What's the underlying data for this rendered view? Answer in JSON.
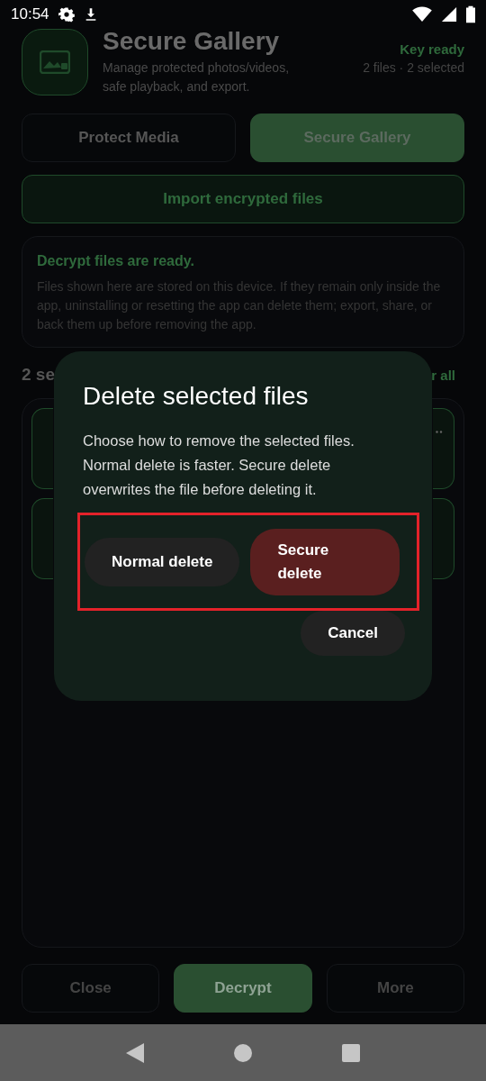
{
  "status_bar": {
    "time": "10:54"
  },
  "header": {
    "title": "Secure Gallery",
    "subtitle": "Manage protected photos/videos, safe playback, and export.",
    "key_status": "Key ready",
    "counts": "2 files · 2 selected"
  },
  "tabs": [
    {
      "label": "Protect Media",
      "selected": false
    },
    {
      "label": "Secure Gallery",
      "selected": true
    }
  ],
  "import_button": "Import encrypted files",
  "notice": {
    "title": "Decrypt files are ready.",
    "body": "Files shown here are stored on this device. If they remain only inside the app, uninstalling or resetting the app can delete them; export, share, or back them up before removing the app."
  },
  "list_header": {
    "count": "2 se",
    "action": "r all"
  },
  "files": [
    {
      "selected": true
    },
    {
      "selected": true
    }
  ],
  "bottom_buttons": [
    {
      "label": "Close",
      "primary": false
    },
    {
      "label": "Decrypt",
      "primary": true
    },
    {
      "label": "More",
      "primary": false
    }
  ],
  "dialog": {
    "title": "Delete selected files",
    "body": "Choose how to remove the selected files. Normal delete is faster. Secure delete overwrites the file before deleting it.",
    "actions": [
      {
        "label": "Normal delete",
        "kind": "neutral"
      },
      {
        "label": "Secure delete",
        "kind": "danger"
      }
    ],
    "cancel": "Cancel"
  }
}
